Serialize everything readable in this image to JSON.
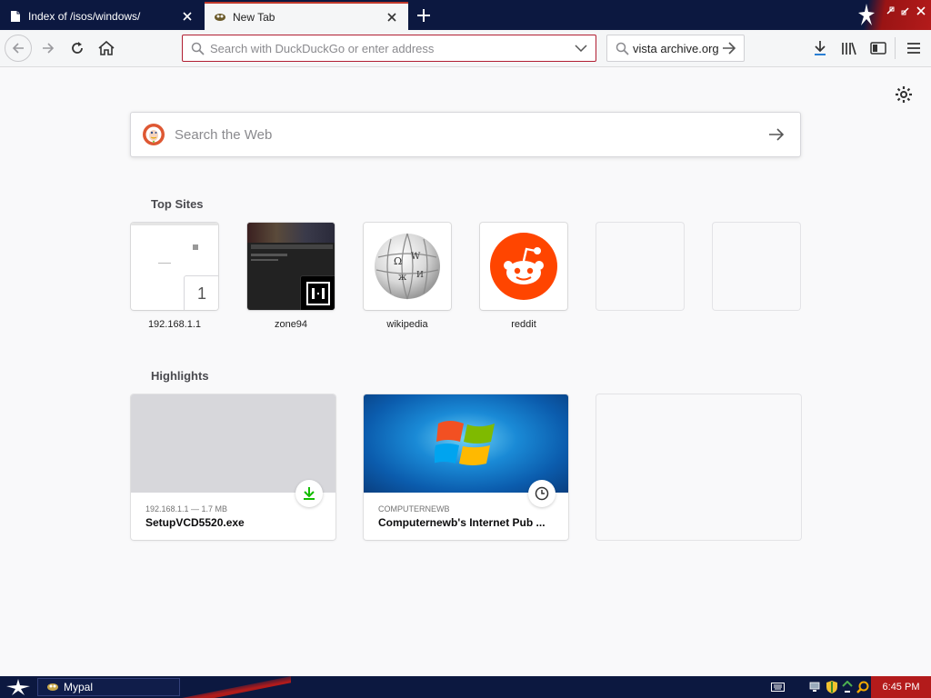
{
  "tabs": [
    {
      "title": "Index of /isos/windows/",
      "active": false
    },
    {
      "title": "New Tab",
      "active": true
    }
  ],
  "navbar": {
    "url_placeholder": "Search with DuckDuckGo or enter address",
    "search_value": "vista archive.org"
  },
  "content": {
    "websearch_placeholder": "Search the Web",
    "top_sites_heading": "Top Sites",
    "top_sites": [
      {
        "label": "192.168.1.1",
        "badge": "1"
      },
      {
        "label": "zone94"
      },
      {
        "label": "wikipedia"
      },
      {
        "label": "reddit"
      }
    ],
    "highlights_heading": "Highlights",
    "highlights": [
      {
        "meta": "192.168.1.1 — 1.7 MB",
        "title": "SetupVCD5520.exe",
        "badge_icon": "download-icon"
      },
      {
        "meta": "COMPUTERNEWB",
        "title": "Computernewb's Internet Pub ...",
        "badge_icon": "clock-icon"
      }
    ]
  },
  "taskbar": {
    "task_label": "Mypal",
    "clock": "6:45 PM"
  },
  "colors": {
    "tab_strip": "#0c1840",
    "accent_red": "#b31b1b",
    "reddit_orange": "#ff4500",
    "download_green": "#12bc00"
  }
}
